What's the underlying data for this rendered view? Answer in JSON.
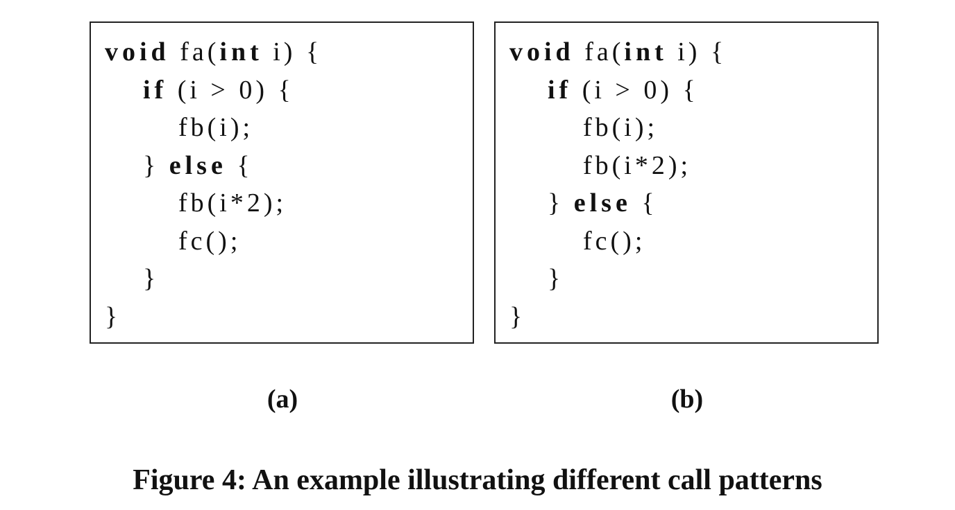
{
  "panels": [
    {
      "label": "(a)",
      "lines": [
        {
          "indent": 0,
          "tokens": [
            {
              "t": "void",
              "kw": true
            },
            {
              "t": " fa(",
              "kw": false
            },
            {
              "t": "int",
              "kw": true
            },
            {
              "t": " i) {",
              "kw": false
            }
          ]
        },
        {
          "indent": 1,
          "tokens": [
            {
              "t": "if",
              "kw": true
            },
            {
              "t": " (i > 0) {",
              "kw": false
            }
          ]
        },
        {
          "indent": 2,
          "tokens": [
            {
              "t": "fb(i);",
              "kw": false
            }
          ]
        },
        {
          "indent": 1,
          "tokens": [
            {
              "t": "} ",
              "kw": false
            },
            {
              "t": "else",
              "kw": true
            },
            {
              "t": " {",
              "kw": false
            }
          ]
        },
        {
          "indent": 2,
          "tokens": [
            {
              "t": "fb(i*2);",
              "kw": false
            }
          ]
        },
        {
          "indent": 2,
          "tokens": [
            {
              "t": "fc();",
              "kw": false
            }
          ]
        },
        {
          "indent": 1,
          "tokens": [
            {
              "t": "}",
              "kw": false
            }
          ]
        },
        {
          "indent": 0,
          "tokens": [
            {
              "t": "}",
              "kw": false
            }
          ]
        }
      ]
    },
    {
      "label": "(b)",
      "lines": [
        {
          "indent": 0,
          "tokens": [
            {
              "t": "void",
              "kw": true
            },
            {
              "t": " fa(",
              "kw": false
            },
            {
              "t": "int",
              "kw": true
            },
            {
              "t": " i) {",
              "kw": false
            }
          ]
        },
        {
          "indent": 1,
          "tokens": [
            {
              "t": "if",
              "kw": true
            },
            {
              "t": " (i > 0) {",
              "kw": false
            }
          ]
        },
        {
          "indent": 2,
          "tokens": [
            {
              "t": "fb(i);",
              "kw": false
            }
          ]
        },
        {
          "indent": 2,
          "tokens": [
            {
              "t": "fb(i*2);",
              "kw": false
            }
          ]
        },
        {
          "indent": 1,
          "tokens": [
            {
              "t": "} ",
              "kw": false
            },
            {
              "t": "else",
              "kw": true
            },
            {
              "t": " {",
              "kw": false
            }
          ]
        },
        {
          "indent": 2,
          "tokens": [
            {
              "t": "fc();",
              "kw": false
            }
          ]
        },
        {
          "indent": 1,
          "tokens": [
            {
              "t": "}",
              "kw": false
            }
          ]
        },
        {
          "indent": 0,
          "tokens": [
            {
              "t": "}",
              "kw": false
            }
          ]
        }
      ]
    }
  ],
  "caption": "Figure 4: An example illustrating different call patterns"
}
